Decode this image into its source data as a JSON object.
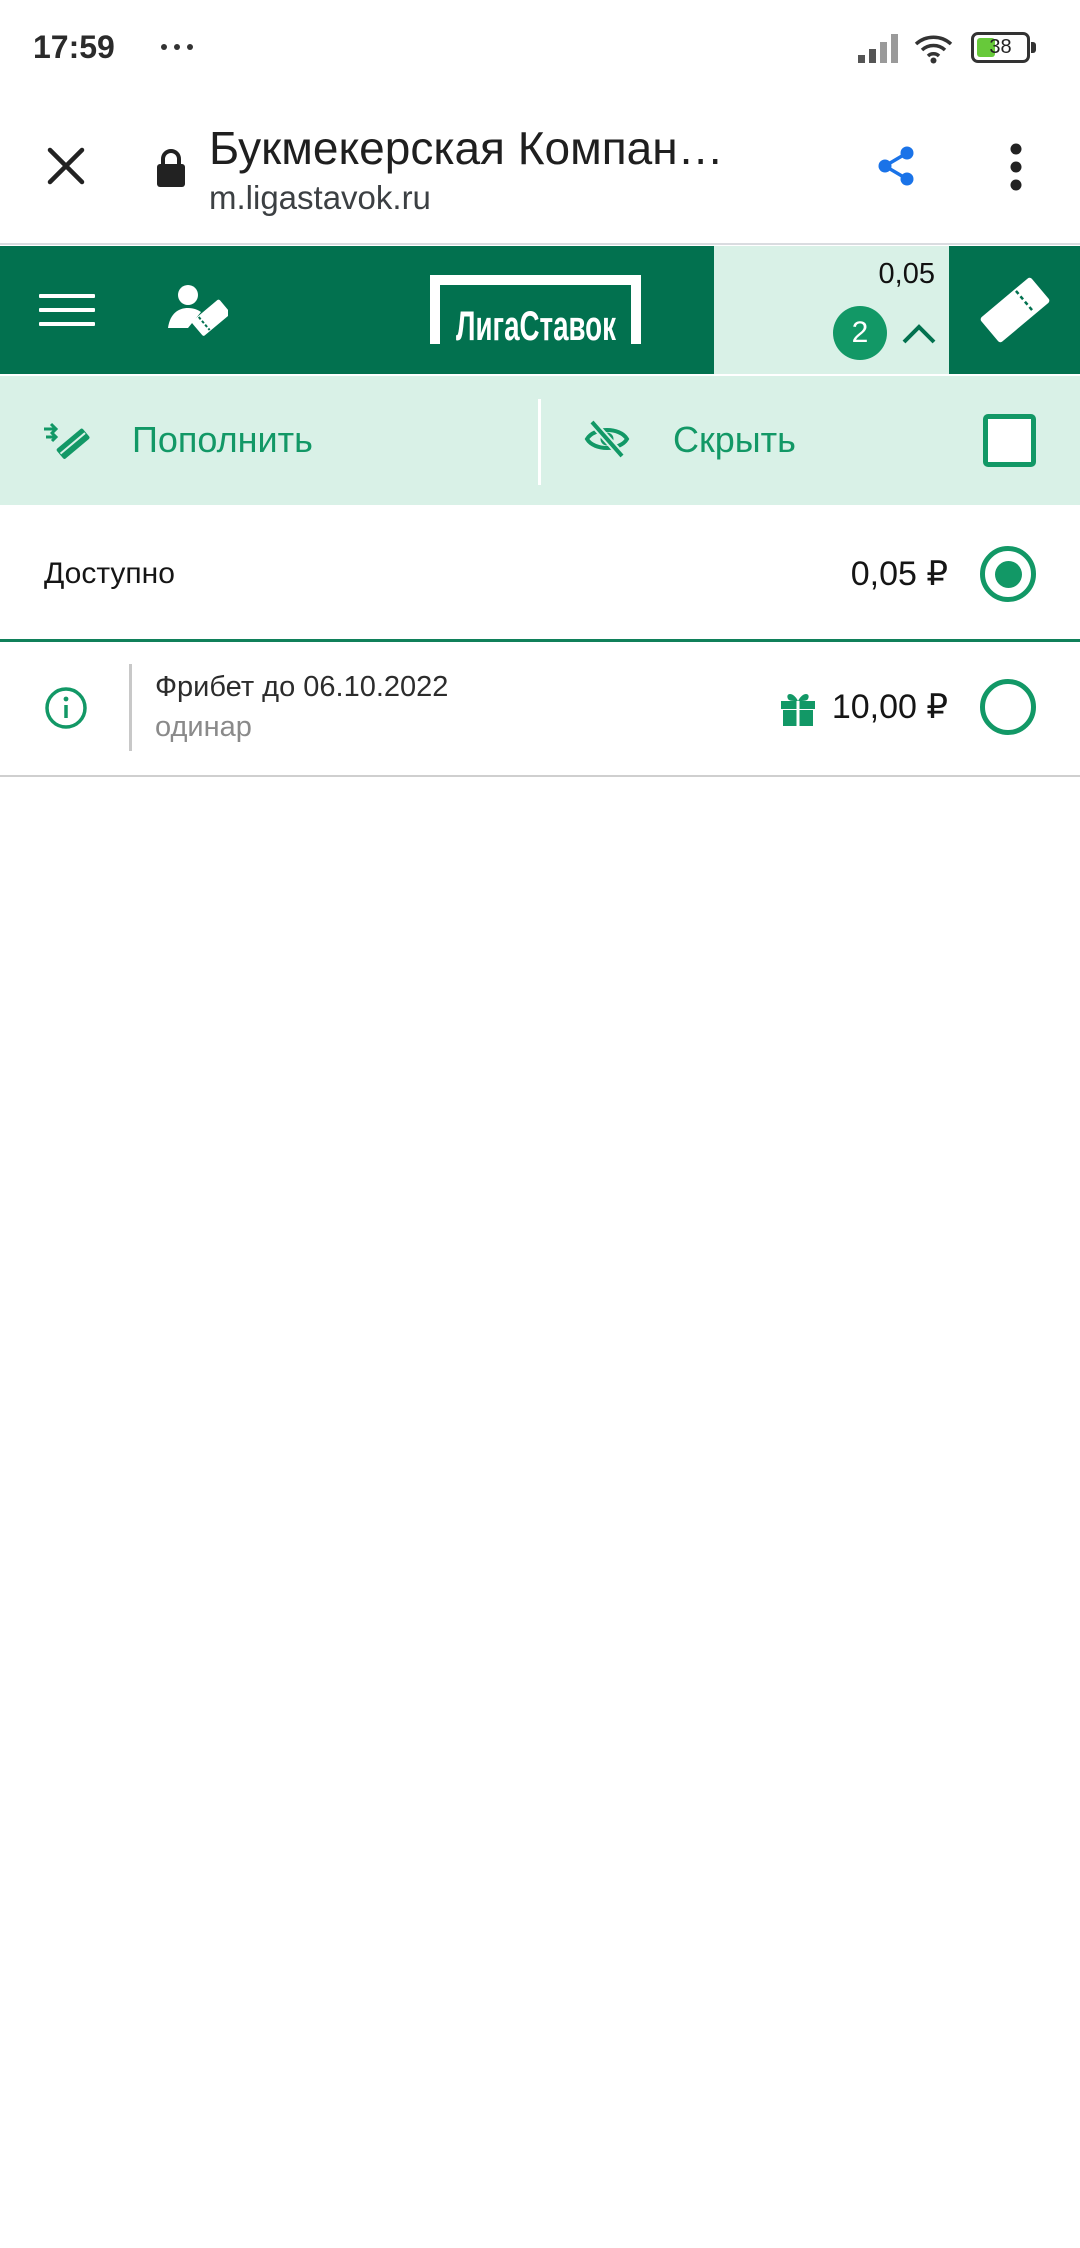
{
  "status_bar": {
    "time": "17:59",
    "battery": "38"
  },
  "browser": {
    "title": "Букмекерская Компан…",
    "url": "m.ligastavok.ru"
  },
  "header": {
    "logo_text": "ЛигаСтавок",
    "balance": "0,05",
    "bet_count": "2"
  },
  "actions": {
    "deposit_label": "Пополнить",
    "hide_label": "Скрыть",
    "hide_checked": false
  },
  "balances": [
    {
      "label": "Доступно",
      "amount": "0,05 ₽",
      "selected": true
    },
    {
      "label": "Фрибет до 06.10.2022",
      "sublabel": "одинар",
      "amount": "10,00 ₽",
      "selected": false
    }
  ],
  "colors": {
    "brand_green": "#02714f",
    "accent_green": "#129866",
    "mint": "#d9f1e7",
    "browser_blue": "#1a73e8",
    "battery_green": "#67c93a"
  },
  "icons": {
    "status": [
      "notification-overflow-icon",
      "signal-icon",
      "wifi-icon",
      "battery-icon"
    ],
    "browser": [
      "close-icon",
      "lock-icon",
      "share-icon",
      "more-vert-icon"
    ],
    "header": [
      "hamburger-menu-icon",
      "account-ticket-icon",
      "chevron-up-icon",
      "bet-slip-ticket-icon"
    ],
    "actions": [
      "deposit-icon",
      "eye-off-icon"
    ],
    "rows": [
      "info-icon",
      "gift-icon"
    ]
  }
}
